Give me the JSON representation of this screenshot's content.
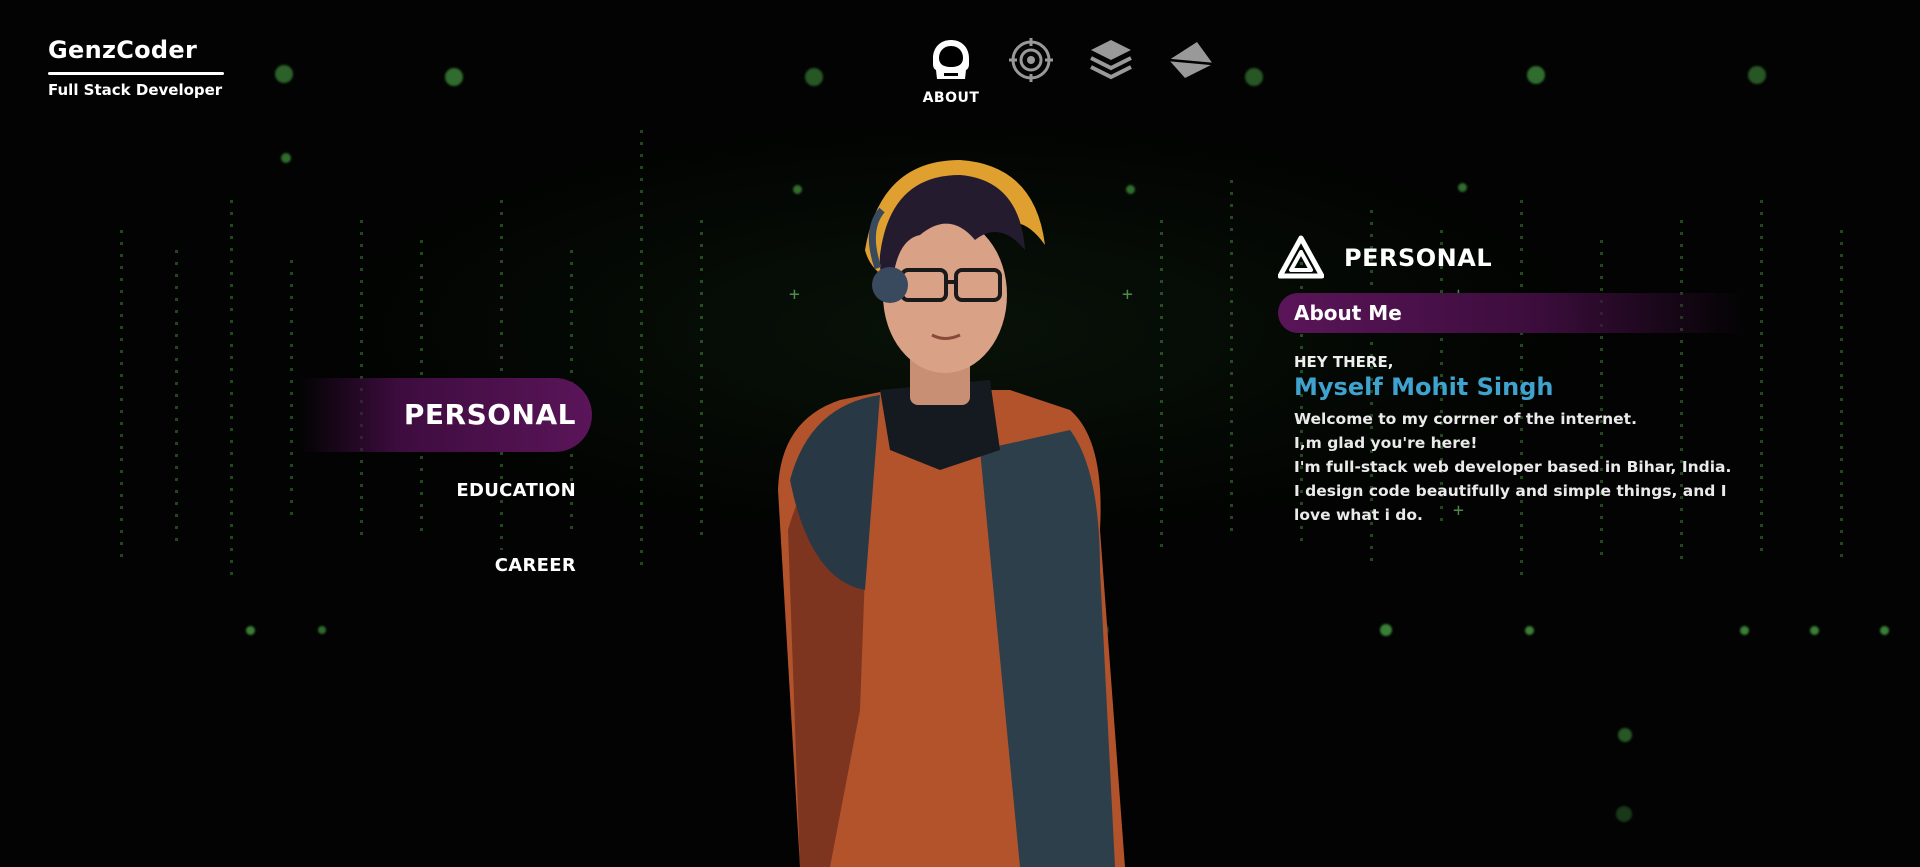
{
  "brand": {
    "name": "GenzCoder",
    "tagline": "Full Stack Developer"
  },
  "topnav": {
    "items": [
      {
        "label": "ABOUT",
        "icon": "astronaut-helmet-icon",
        "active": true
      },
      {
        "label": "",
        "icon": "target-icon",
        "active": false
      },
      {
        "label": "",
        "icon": "layers-icon",
        "active": false
      },
      {
        "label": "",
        "icon": "envelope-icon",
        "active": false
      }
    ]
  },
  "sidebar": {
    "items": [
      {
        "label": "PERSONAL",
        "active": true
      },
      {
        "label": "EDUCATION",
        "active": false
      },
      {
        "label": "CAREER",
        "active": false
      }
    ]
  },
  "panel": {
    "icon": "triangle-logo-icon",
    "title": "PERSONAL",
    "section": "About Me",
    "greeting": "HEY THERE,",
    "name": "Myself Mohit Singh",
    "lines": [
      "Welcome to my corrner of the internet.",
      "I,m glad you're here!",
      "I'm full-stack web developer based in Bihar, India. I design code beautifully and simple things, and I love what i do."
    ]
  },
  "colors": {
    "accent_purple": "#5a1559",
    "name_blue": "#3fa3cf",
    "matrix_green": "#5fd45a"
  }
}
